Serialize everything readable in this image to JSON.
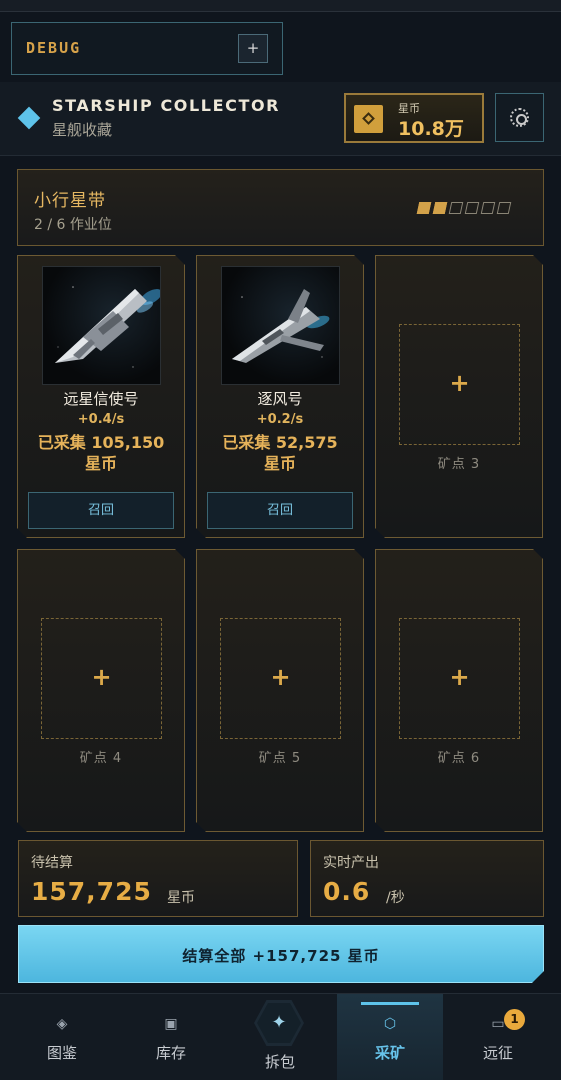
{
  "debug": {
    "label": "DEBUG",
    "toggle": "+"
  },
  "header": {
    "title": "STARSHIP COLLECTOR",
    "subtitle": "星舰收藏",
    "currency_label": "星币",
    "currency_value": "10.8万"
  },
  "belt": {
    "name": "小行星带",
    "slots_text": "2 / 6 作业位",
    "slots_total": 6,
    "slots_used": 2
  },
  "ships": [
    {
      "name": "远星信使号",
      "rate": "+0.4/s",
      "collected": "已采集 105,150",
      "collected_unit": "星币",
      "recall_label": "召回"
    },
    {
      "name": "逐风号",
      "rate": "+0.2/s",
      "collected": "已采集 52,575",
      "collected_unit": "星币",
      "recall_label": "召回"
    }
  ],
  "empty_slots": [
    {
      "plus": "+",
      "label": "矿点 3"
    },
    {
      "plus": "+",
      "label": "矿点 4"
    },
    {
      "plus": "+",
      "label": "矿点 5"
    },
    {
      "plus": "+",
      "label": "矿点 6"
    }
  ],
  "stats": {
    "pending_label": "待结算",
    "pending_value": "157,725",
    "pending_unit": "星币",
    "rate_label": "实时产出",
    "rate_value": "0.6",
    "rate_unit": "/秒"
  },
  "settle_button": "结算全部 +157,725 星币",
  "nav": {
    "items": [
      {
        "label": "图鉴",
        "icon": "◈"
      },
      {
        "label": "库存",
        "icon": "▣"
      },
      {
        "label": "拆包",
        "icon": "✦"
      },
      {
        "label": "采矿",
        "icon": "⬡"
      },
      {
        "label": "远征",
        "icon": "▭",
        "badge": "1"
      }
    ],
    "active": "采矿"
  },
  "colors": {
    "accent_gold": "#e6b35a",
    "accent_cyan": "#5ec3ea",
    "background": "#0f151d"
  }
}
